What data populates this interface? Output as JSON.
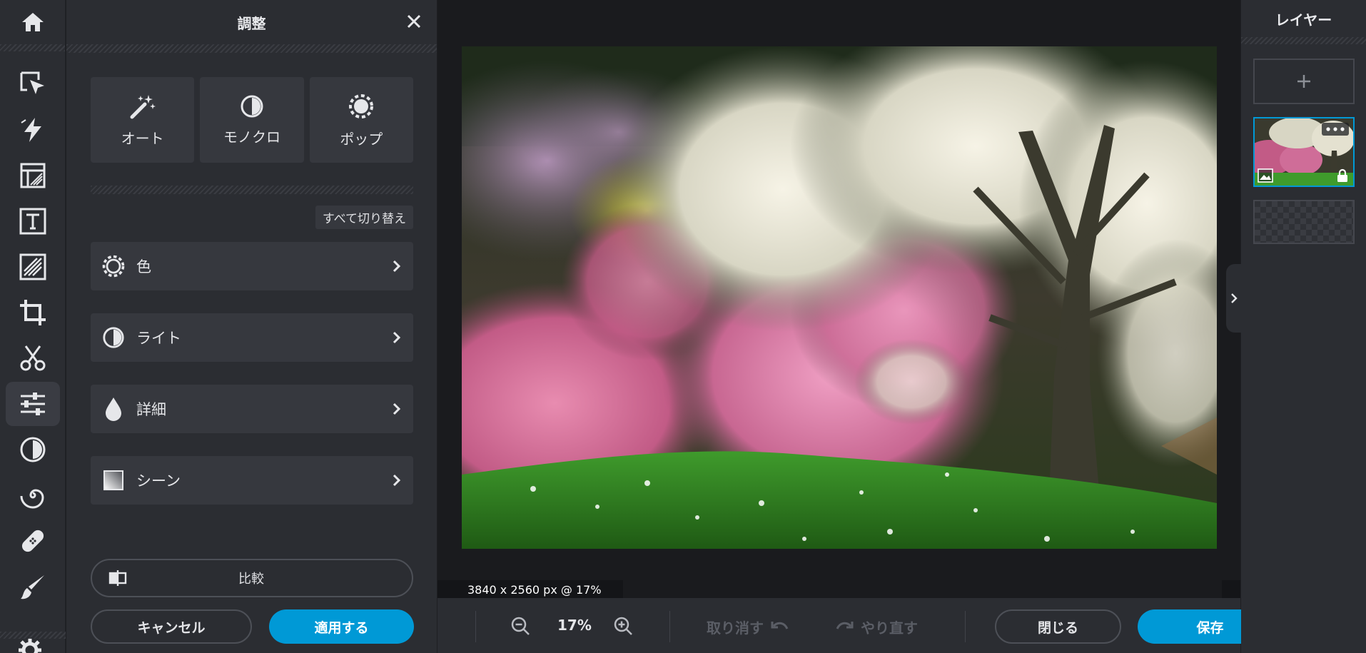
{
  "adjust_panel": {
    "title": "調整",
    "presets": [
      {
        "label": "オート",
        "icon": "magic-wand-icon"
      },
      {
        "label": "モノクロ",
        "icon": "half-circle-icon"
      },
      {
        "label": "ポップ",
        "icon": "sun-icon"
      }
    ],
    "toggle_all": "すべて切り替え",
    "sections": [
      {
        "label": "色",
        "icon": "sun-icon"
      },
      {
        "label": "ライト",
        "icon": "half-circle-icon"
      },
      {
        "label": "詳細",
        "icon": "droplet-icon"
      },
      {
        "label": "シーン",
        "icon": "gradient-square-icon"
      }
    ],
    "compare": "比較",
    "cancel": "キャンセル",
    "apply": "適用する"
  },
  "canvas": {
    "dimensions": "3840 x 2560 px @ 17%"
  },
  "bottom_bar": {
    "zoom": "17%",
    "undo": "取り消す",
    "redo": "やり直す",
    "close": "閉じる",
    "save": "保存"
  },
  "layers_panel": {
    "title": "レイヤー"
  },
  "colors": {
    "accent": "#0099d6",
    "panel": "#2b2d32",
    "canvas": "#1a1b1e"
  }
}
